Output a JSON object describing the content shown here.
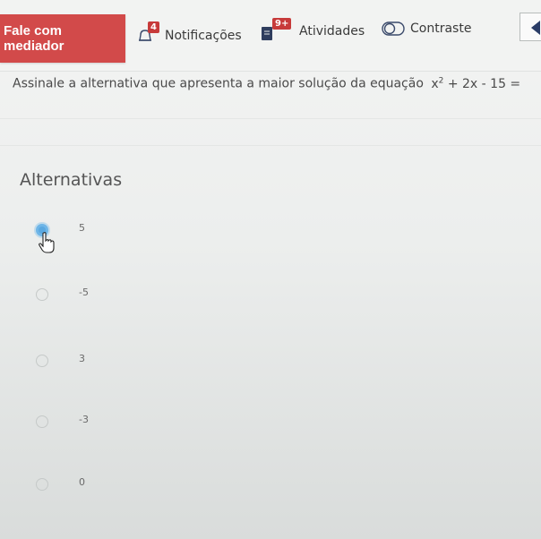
{
  "header": {
    "mediator_button": "Fale com mediador",
    "notifications": {
      "label": "Notificações",
      "badge": "4"
    },
    "activities": {
      "label": "Atividades",
      "badge": "9+"
    },
    "contrast": {
      "label": "Contraste"
    }
  },
  "question": {
    "text": "Assinale a alternativa que apresenta a maior solução da equação",
    "equation_x": "x",
    "equation_exp": "2",
    "equation_rest": " + 2x - 15 = "
  },
  "alternatives": {
    "title": "Alternativas",
    "options": [
      {
        "label": "5",
        "selected": true
      },
      {
        "label": "-5",
        "selected": false
      },
      {
        "label": "3",
        "selected": false
      },
      {
        "label": "-3",
        "selected": false
      },
      {
        "label": "0",
        "selected": false
      }
    ]
  },
  "colors": {
    "mediator_bg": "#d24a4a",
    "badge_bg": "#c73a3a",
    "radio_selected": "#5aa8e0"
  },
  "icons": [
    "bell-icon",
    "book-icon",
    "contrast-icon",
    "hand-cursor-icon",
    "speaker-icon"
  ]
}
